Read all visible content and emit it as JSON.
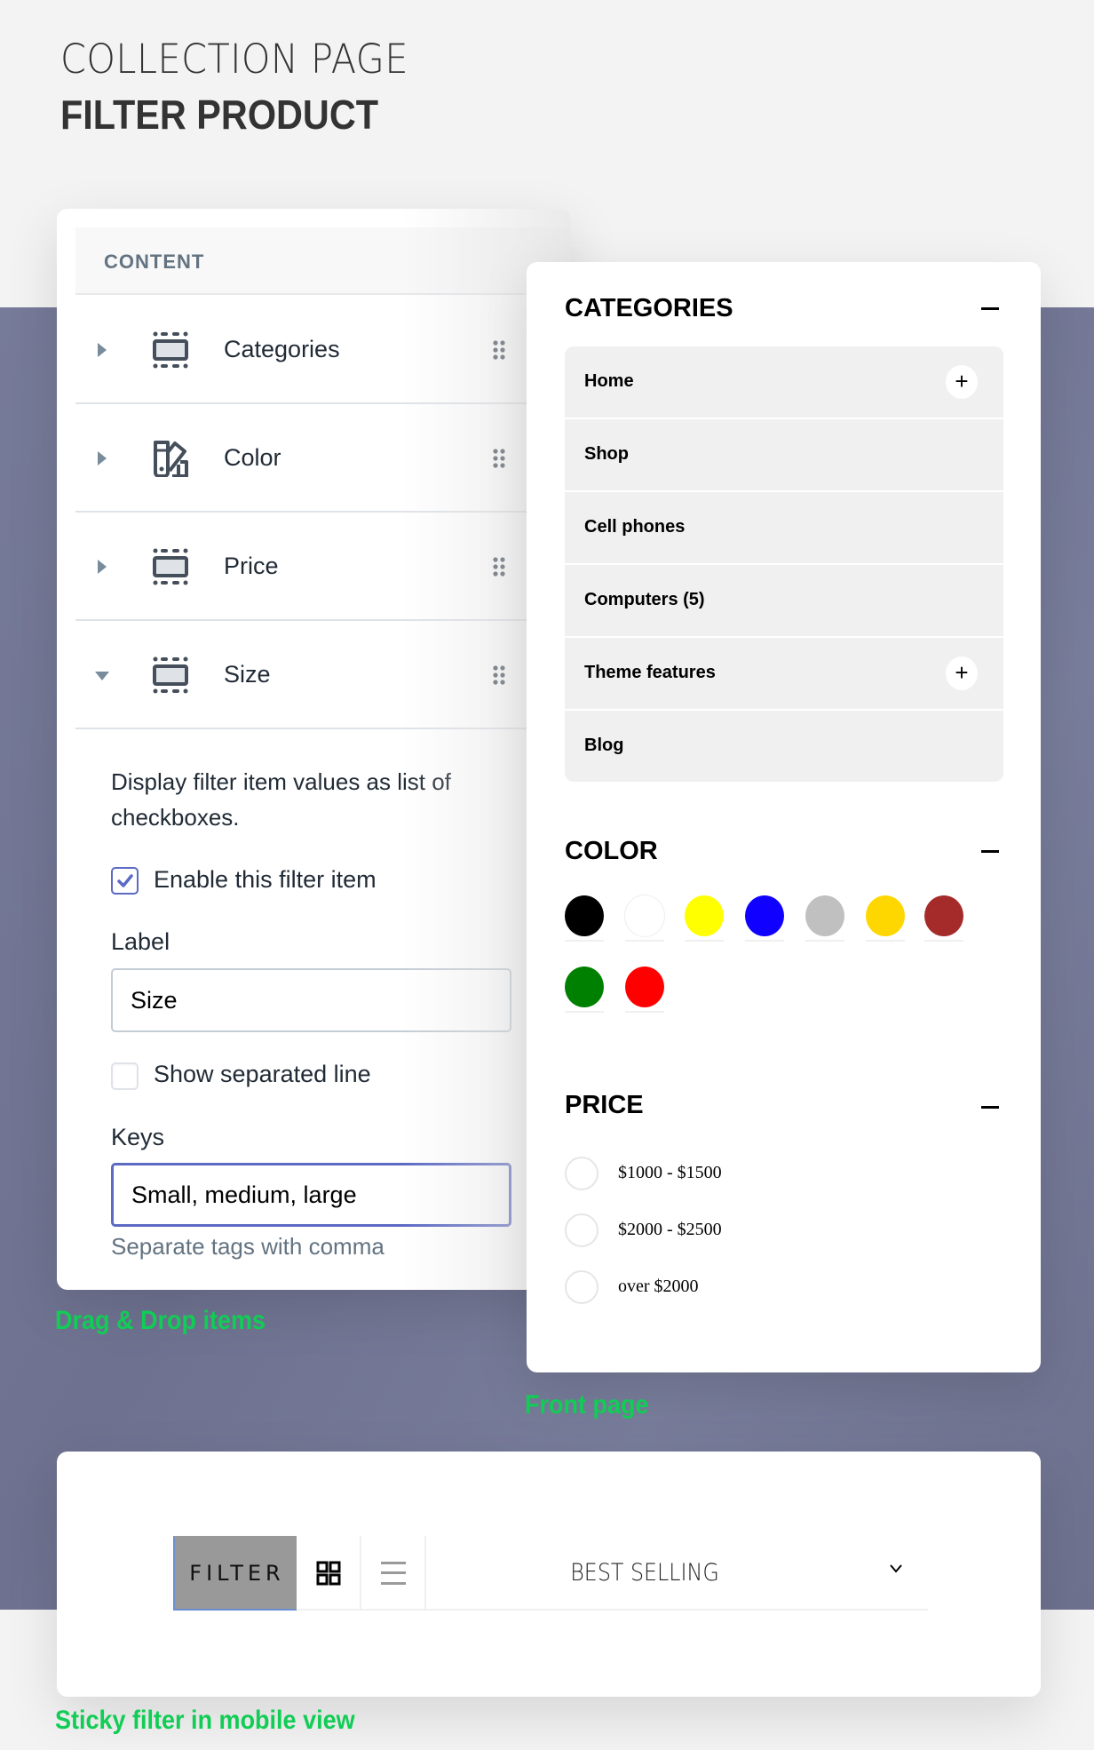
{
  "header": {
    "title_light": "COLLECTION PAGE",
    "title_bold": "FILTER PRODUCT"
  },
  "admin": {
    "section_label": "CONTENT",
    "items": [
      {
        "label": "Categories",
        "icon": "section-block-icon",
        "expanded": false
      },
      {
        "label": "Color",
        "icon": "color-palette-icon",
        "expanded": false
      },
      {
        "label": "Price",
        "icon": "section-block-icon",
        "expanded": false
      },
      {
        "label": "Size",
        "icon": "section-block-icon",
        "expanded": true
      }
    ],
    "settings": {
      "description": "Display filter item values as list of checkboxes.",
      "enable_label": "Enable this filter item",
      "enable_checked": true,
      "label_field_label": "Label",
      "label_field_value": "Size",
      "separated_line_label": "Show separated line",
      "separated_line_checked": false,
      "keys_field_label": "Keys",
      "keys_field_value": "Small, medium, large",
      "keys_help": "Separate tags with comma"
    },
    "caption": "Drag & Drop items"
  },
  "front": {
    "categories": {
      "title": "CATEGORIES",
      "items": [
        {
          "name": "Home",
          "has_children": true
        },
        {
          "name": "Shop",
          "has_children": false
        },
        {
          "name": "Cell phones",
          "has_children": false
        },
        {
          "name": "Computers (5)",
          "has_children": false
        },
        {
          "name": "Theme features",
          "has_children": true
        },
        {
          "name": "Blog",
          "has_children": false
        }
      ],
      "expand_symbol": "+"
    },
    "color": {
      "title": "COLOR",
      "swatches": [
        {
          "name": "black",
          "hex": "#000000"
        },
        {
          "name": "white",
          "hex": "#ffffff"
        },
        {
          "name": "yellow",
          "hex": "#ffff00"
        },
        {
          "name": "blue",
          "hex": "#0f00ff"
        },
        {
          "name": "silver",
          "hex": "#c0c0c0"
        },
        {
          "name": "gold",
          "hex": "#ffd700"
        },
        {
          "name": "brown",
          "hex": "#a52a2a"
        },
        {
          "name": "green",
          "hex": "#008000"
        },
        {
          "name": "red",
          "hex": "#ff0000"
        }
      ]
    },
    "price": {
      "title": "PRICE",
      "options": [
        "$1000 - $1500",
        "$2000 - $2500",
        "over $2000"
      ]
    },
    "caption": "Front page"
  },
  "mobile": {
    "filter_label": "FILTER",
    "sort_value": "BEST SELLING",
    "caption": "Sticky filter in mobile view"
  },
  "colors": {
    "accent": "#5c6ac4",
    "caption_green": "#11cc55",
    "band": "#747996"
  }
}
